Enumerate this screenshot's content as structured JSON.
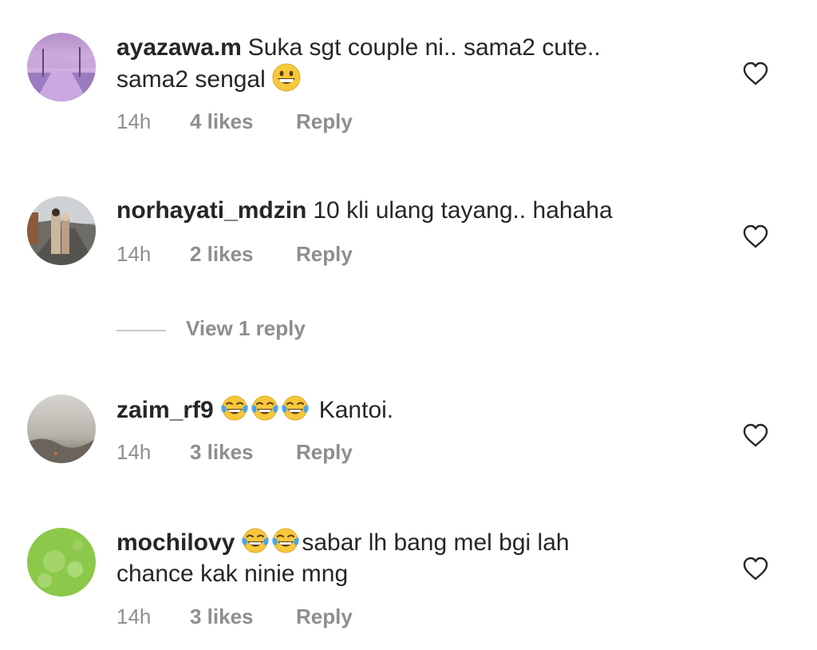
{
  "comments": [
    {
      "username": "ayazawa.m",
      "text_line1": "Suka sgt couple ni.. sama2 cute..",
      "text_line2": "sama2 sengal",
      "time": "14h",
      "likes": "4 likes",
      "reply": "Reply",
      "avatar_colors": [
        "#c9a3d9",
        "#6b4e8c"
      ]
    },
    {
      "username": "norhayati_mdzin",
      "text": "10 kli ulang tayang.. hahaha",
      "time": "14h",
      "likes": "2 likes",
      "reply": "Reply",
      "avatar_colors": [
        "#8a8578",
        "#5a5a55"
      ]
    },
    {
      "username": "zaim_rf9",
      "text": "Kantoi.",
      "time": "14h",
      "likes": "3 likes",
      "reply": "Reply",
      "avatar_colors": [
        "#c9c9c3",
        "#6f6a63"
      ]
    },
    {
      "username": "mochilovy",
      "text_line1": "sabar lh bang mel bgi lah",
      "text_line2": "chance kak ninie mng",
      "time": "14h",
      "likes": "3 likes",
      "reply": "Reply",
      "avatar_colors": [
        "#8fc94a",
        "#b9df8a"
      ]
    }
  ],
  "view_replies": "View 1 reply",
  "icons": {
    "like": "heart-outline-icon",
    "grin_emoji": "grinning-face-emoji",
    "laugh_emoji": "tears-of-joy-emoji"
  },
  "colors": {
    "text": "#262626",
    "secondary": "#8e8e8e",
    "emoji_face": "#f7c83a",
    "emoji_tears": "#4aa3e8"
  }
}
